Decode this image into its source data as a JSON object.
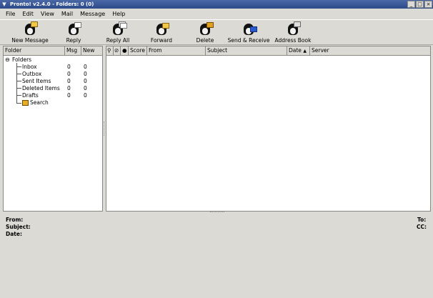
{
  "window": {
    "title": "Pronto! v2.4.0 - Folders: 0 (0)",
    "buttons": {
      "minimize": "_",
      "maximize": "□",
      "close": "×"
    }
  },
  "menubar": [
    "File",
    "Edit",
    "View",
    "Mail",
    "Message",
    "Help"
  ],
  "toolbar": [
    {
      "label": "New Message",
      "icon": "new-message-icon"
    },
    {
      "label": "Reply",
      "icon": "reply-icon"
    },
    {
      "label": "Reply All",
      "icon": "reply-all-icon"
    },
    {
      "label": "Forward",
      "icon": "forward-icon"
    },
    {
      "label": "Delete",
      "icon": "delete-icon"
    },
    {
      "label": "Send & Receive",
      "icon": "send-receive-icon"
    },
    {
      "label": "Address Book",
      "icon": "address-book-icon"
    }
  ],
  "folder_pane": {
    "columns": {
      "folder": "Folder",
      "msg": "Msg",
      "new": "New"
    },
    "root": "Folders",
    "folders": [
      {
        "name": "Inbox",
        "msg": "0",
        "new": "0"
      },
      {
        "name": "Outbox",
        "msg": "0",
        "new": "0"
      },
      {
        "name": "Sent Items",
        "msg": "0",
        "new": "0"
      },
      {
        "name": "Deleted Items",
        "msg": "0",
        "new": "0"
      },
      {
        "name": "Drafts",
        "msg": "0",
        "new": "0"
      }
    ],
    "search": "Search"
  },
  "message_pane": {
    "columns": {
      "score": "Score",
      "from": "From",
      "subject": "Subject",
      "date": "Date",
      "date_sort": "▲",
      "server": "Server"
    }
  },
  "preview": {
    "from": "From:",
    "subject": "Subject:",
    "date": "Date:",
    "to": "To:",
    "cc": "CC:"
  },
  "colors": {
    "titlebar": "#3a5898",
    "background": "#dcdad5"
  }
}
